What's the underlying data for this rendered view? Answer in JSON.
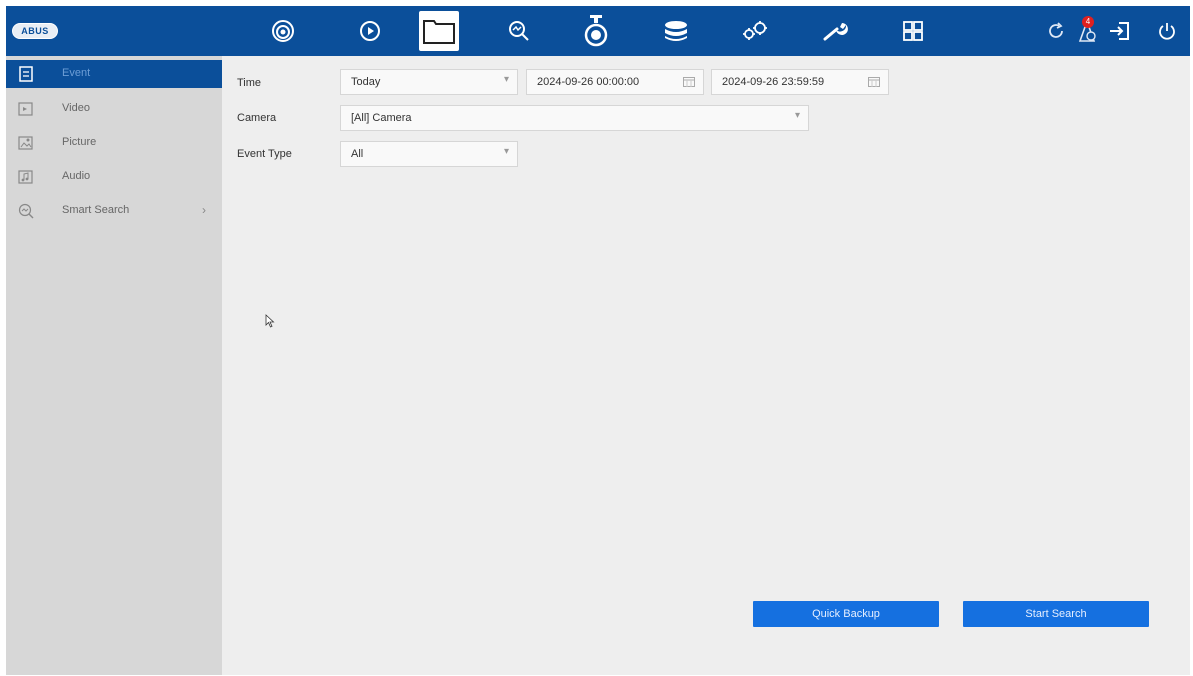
{
  "brand": {
    "logo_text": "ABUS"
  },
  "topnav": {
    "items": [
      {
        "name": "live-view",
        "icon": "camera-dome-icon"
      },
      {
        "name": "playback",
        "icon": "play-circle-icon"
      },
      {
        "name": "file-management",
        "icon": "folder-icon",
        "active": true
      },
      {
        "name": "smart-analysis",
        "icon": "search-chart-icon"
      },
      {
        "name": "configuration",
        "icon": "camera-config-icon"
      },
      {
        "name": "storage",
        "icon": "database-icon"
      },
      {
        "name": "system",
        "icon": "gears-icon"
      },
      {
        "name": "maintenance",
        "icon": "wrench-icon"
      },
      {
        "name": "multi-view",
        "icon": "grid-icon"
      }
    ],
    "right": [
      {
        "name": "refresh",
        "icon": "refresh-icon"
      },
      {
        "name": "alarms",
        "icon": "alarm-icon",
        "badge": "4"
      },
      {
        "name": "logout",
        "icon": "logout-icon"
      },
      {
        "name": "power",
        "icon": "power-icon"
      }
    ]
  },
  "sidebar": {
    "items": [
      {
        "label": "Event",
        "icon": "event-icon",
        "active": true
      },
      {
        "label": "Video",
        "icon": "video-file-icon"
      },
      {
        "label": "Picture",
        "icon": "picture-icon"
      },
      {
        "label": "Audio",
        "icon": "audio-icon"
      },
      {
        "label": "Smart Search",
        "icon": "smart-search-icon",
        "has_submenu": true,
        "chevron": "›"
      }
    ]
  },
  "form": {
    "time": {
      "label": "Time",
      "value": "Today",
      "start": "2024-09-26 00:00:00",
      "end": "2024-09-26 23:59:59"
    },
    "camera": {
      "label": "Camera",
      "value": "[All] Camera"
    },
    "event_type": {
      "label": "Event Type",
      "value": "All"
    }
  },
  "actions": {
    "quick_backup": "Quick Backup",
    "start_search": "Start Search"
  },
  "colors": {
    "topbar": "#0b4f9a",
    "active": "#0b4f9a",
    "button": "#1570e0",
    "sidebar": "#d7d7d7",
    "content": "#eeeeee"
  }
}
